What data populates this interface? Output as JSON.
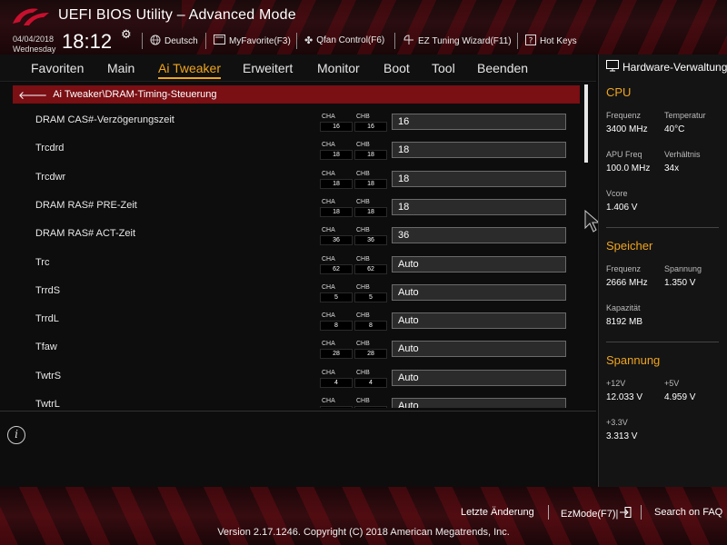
{
  "header": {
    "title": "UEFI BIOS Utility – Advanced Mode",
    "date": "04/04/2018",
    "weekday": "Wednesday",
    "time": "18:12",
    "items": [
      {
        "label": "Deutsch",
        "icon": "globe-icon"
      },
      {
        "label": "MyFavorite(F3)",
        "icon": "favorite-icon"
      },
      {
        "label": "Qfan Control(F6)",
        "icon": "fan-icon"
      },
      {
        "label": "EZ Tuning Wizard(F11)",
        "icon": "wizard-icon"
      },
      {
        "label": "Hot Keys",
        "icon": "help-icon"
      }
    ]
  },
  "nav": {
    "tabs": [
      {
        "label": "Favoriten"
      },
      {
        "label": "Main"
      },
      {
        "label": "Ai Tweaker",
        "active": true
      },
      {
        "label": "Erweitert"
      },
      {
        "label": "Monitor"
      },
      {
        "label": "Boot"
      },
      {
        "label": "Tool"
      },
      {
        "label": "Beenden"
      }
    ]
  },
  "breadcrumb": "Ai Tweaker\\DRAM-Timing-Steuerung",
  "rows": [
    {
      "label": "DRAM CAS#-Verzögerungszeit",
      "cha": "16",
      "chb": "16",
      "value": "16"
    },
    {
      "label": "Trcdrd",
      "cha": "18",
      "chb": "18",
      "value": "18"
    },
    {
      "label": "Trcdwr",
      "cha": "18",
      "chb": "18",
      "value": "18"
    },
    {
      "label": "DRAM RAS# PRE-Zeit",
      "cha": "18",
      "chb": "18",
      "value": "18"
    },
    {
      "label": "DRAM RAS# ACT-Zeit",
      "cha": "36",
      "chb": "36",
      "value": "36"
    },
    {
      "label": "Trc",
      "cha": "62",
      "chb": "62",
      "value": "Auto"
    },
    {
      "label": "TrrdS",
      "cha": "5",
      "chb": "5",
      "value": "Auto"
    },
    {
      "label": "TrrdL",
      "cha": "8",
      "chb": "8",
      "value": "Auto"
    },
    {
      "label": "Tfaw",
      "cha": "28",
      "chb": "28",
      "value": "Auto"
    },
    {
      "label": "TwtrS",
      "cha": "4",
      "chb": "4",
      "value": "Auto"
    },
    {
      "label": "TwtrL",
      "cha": "",
      "chb": "",
      "value": "Auto"
    }
  ],
  "channel_labels": {
    "a": "CHA",
    "b": "CHB"
  },
  "hw_monitor": {
    "title": "Hardware-Verwaltung",
    "cpu": {
      "section": "CPU",
      "freq_label": "Frequenz",
      "freq_value": "3400 MHz",
      "temp_label": "Temperatur",
      "temp_value": "40°C",
      "apu_label": "APU Freq",
      "apu_value": "100.0 MHz",
      "ratio_label": "Verhältnis",
      "ratio_value": "34x",
      "vcore_label": "Vcore",
      "vcore_value": "1.406 V"
    },
    "memory": {
      "section": "Speicher",
      "freq_label": "Frequenz",
      "freq_value": "2666 MHz",
      "volt_label": "Spannung",
      "volt_value": "1.350 V",
      "cap_label": "Kapazität",
      "cap_value": "8192 MB"
    },
    "voltage": {
      "section": "Spannung",
      "v12_label": "+12V",
      "v12_value": "12.033 V",
      "v5_label": "+5V",
      "v5_value": "4.959 V",
      "v33_label": "+3.3V",
      "v33_value": "3.313 V"
    }
  },
  "footer": {
    "last_change": "Letzte Änderung",
    "ezmode": "EzMode(F7)|",
    "search": "Search on FAQ",
    "version": "Version 2.17.1246. Copyright (C) 2018 American Megatrends, Inc."
  }
}
